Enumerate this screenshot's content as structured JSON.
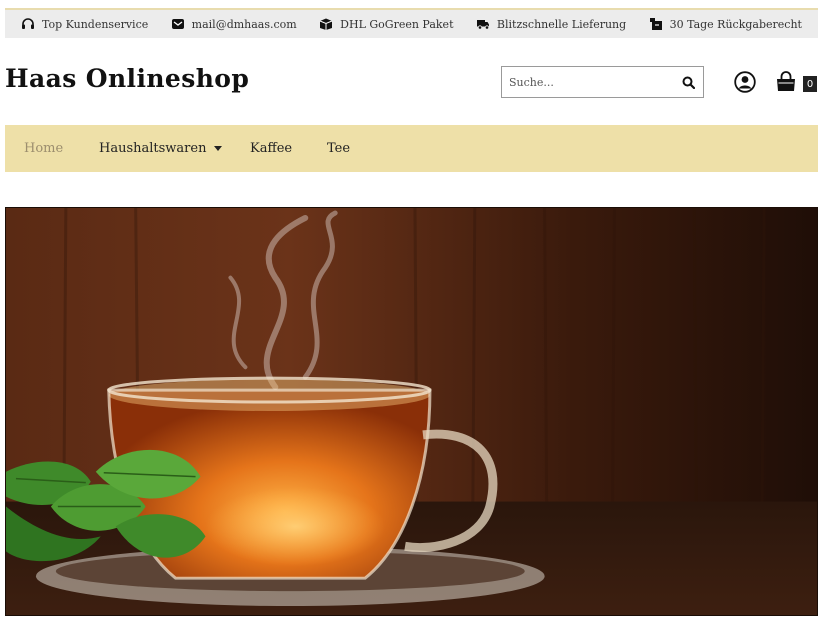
{
  "topbar": {
    "items": [
      {
        "label": "Top Kundenservice",
        "icon": "headset-icon"
      },
      {
        "label": "mail@dmhaas.com",
        "icon": "envelope-icon"
      },
      {
        "label": "DHL GoGreen Paket",
        "icon": "package-icon"
      },
      {
        "label": "Blitzschnelle Lieferung",
        "icon": "truck-icon"
      },
      {
        "label": "30 Tage Rückgaberecht",
        "icon": "return-box-icon"
      }
    ]
  },
  "header": {
    "logo": "Haas Onlineshop",
    "search_placeholder": "Suche...",
    "cart_count": "0"
  },
  "nav": {
    "items": [
      {
        "label": "Home",
        "active": true
      },
      {
        "label": "Haushaltswaren",
        "dropdown": true
      },
      {
        "label": "Kaffee"
      },
      {
        "label": "Tee"
      }
    ]
  },
  "colors": {
    "nav_background": "#eee0a8",
    "topbar_background": "#ececec",
    "active_nav": "#9c8e6e"
  }
}
